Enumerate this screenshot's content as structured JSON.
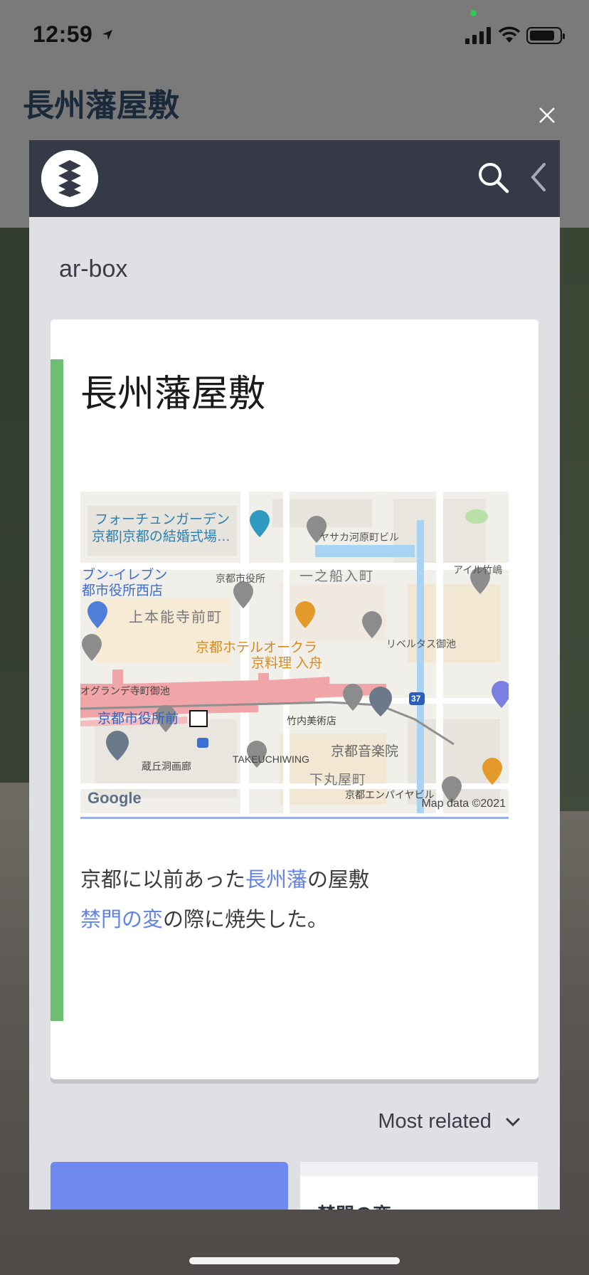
{
  "status": {
    "time": "12:59"
  },
  "page_title": "長州藩屋敷",
  "section_label": "ar-box",
  "card": {
    "title": "長州藩屋敷",
    "description_line1": [
      "京都に以前あった",
      "長州藩",
      "の屋敷"
    ],
    "description_line2": [
      "禁門の変",
      "の際に焼失した。"
    ]
  },
  "map": {
    "labels": [
      "フォーチュンガーデン",
      "京都|京都の結婚式場…",
      "ヤサカ河原町ビル",
      "ブン-イレブン",
      "都市役所西店",
      "京都市役所",
      "一之船入町",
      "アイル竹嶋",
      "上本能寺前町",
      "京都ホテルオークラ",
      "京料理 入舟",
      "リベルタス御池",
      "オグランデ寺町御池",
      "京都市役所前",
      "竹内美術店",
      "京都音楽院",
      "蔵丘洞画廊",
      "TAKEUCHIWING",
      "下丸屋町",
      "京都エンパイヤビル",
      "37"
    ],
    "google": "Google",
    "attribution": "Map data ©2021"
  },
  "sort_label": "Most related",
  "related": [
    {
      "title": ""
    },
    {
      "title": "禁門の変"
    }
  ]
}
